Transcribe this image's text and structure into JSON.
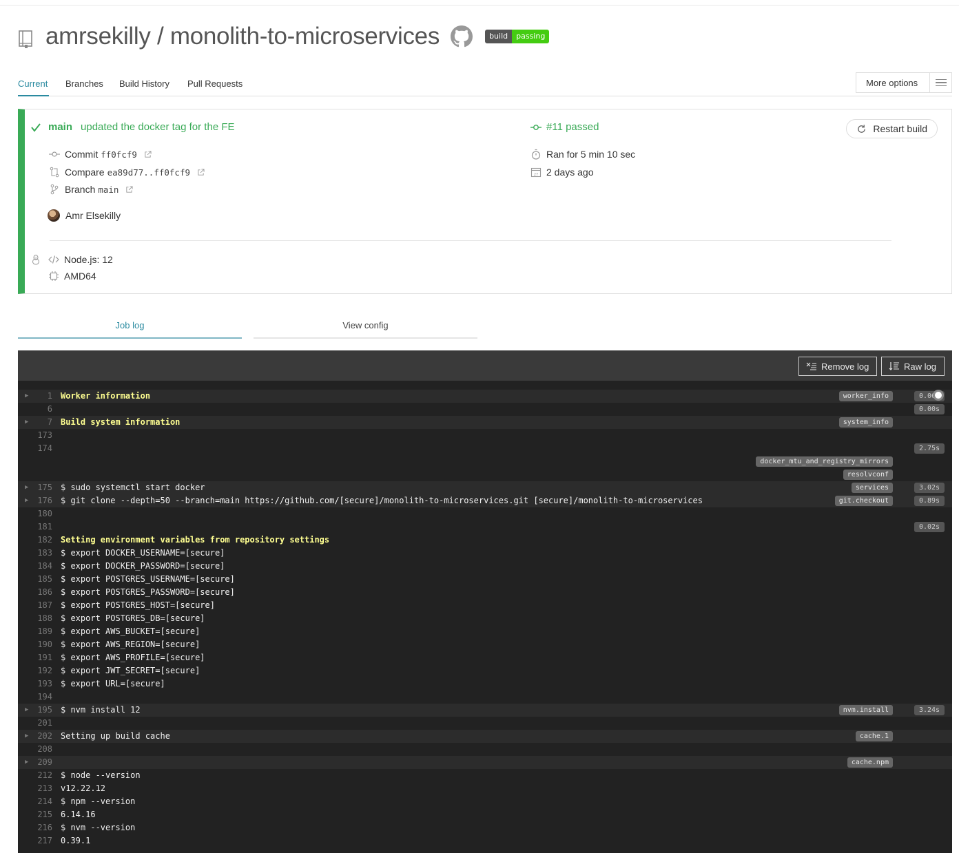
{
  "header": {
    "repo_title": "amrsekilly / monolith-to-microservices",
    "badge_left": "build",
    "badge_right": "passing"
  },
  "tabs": {
    "current": "Current",
    "branches": "Branches",
    "build_history": "Build History",
    "pull_requests": "Pull Requests",
    "more_options": "More options"
  },
  "build": {
    "branch": "main",
    "message": "updated the docker tag for the FE",
    "number_status": "#11 passed",
    "restart_label": "Restart build",
    "commit_label": "Commit",
    "commit_sha": "ff0fcf9",
    "compare_label": "Compare",
    "compare_range": "ea89d77..ff0fcf9",
    "branch_label": "Branch",
    "branch_name": "main",
    "author": "Amr Elsekilly",
    "ran_for": "Ran for 5 min 10 sec",
    "when": "2 days ago",
    "language": "Node.js: 12",
    "arch": "AMD64",
    "status_color": "#39aa56"
  },
  "log_tabs": {
    "job_log": "Job log",
    "view_config": "View config"
  },
  "log_toolbar": {
    "remove_log": "Remove log",
    "raw_log": "Raw log"
  },
  "log": {
    "lines": [
      {
        "num": "1",
        "text": "Worker information",
        "hl": true,
        "fold": true,
        "tag": "worker_info",
        "dur": "0.06s"
      },
      {
        "num": "6",
        "text": "",
        "dur": "0.00s"
      },
      {
        "num": "7",
        "text": "Build system information",
        "hl": true,
        "fold": true,
        "tag": "system_info"
      },
      {
        "num": "173",
        "text": ""
      },
      {
        "num": "174",
        "text": "",
        "dur": "2.75s"
      },
      {
        "num": "",
        "text": "",
        "tag": "docker_mtu_and_registry_mirrors"
      },
      {
        "num": "",
        "text": "",
        "tag": "resolvconf"
      },
      {
        "num": "175",
        "text": "$ sudo systemctl start docker",
        "fold": true,
        "tag": "services",
        "dur": "3.02s"
      },
      {
        "num": "176",
        "text": "$ git clone --depth=50 --branch=main https://github.com/[secure]/monolith-to-microservices.git [secure]/monolith-to-microservices",
        "fold": true,
        "tag": "git.checkout",
        "dur": "0.89s"
      },
      {
        "num": "180",
        "text": ""
      },
      {
        "num": "181",
        "text": "",
        "dur": "0.02s"
      },
      {
        "num": "182",
        "text": "Setting environment variables from repository settings",
        "hl": true
      },
      {
        "num": "183",
        "text": "$ export DOCKER_USERNAME=[secure]"
      },
      {
        "num": "184",
        "text": "$ export DOCKER_PASSWORD=[secure]"
      },
      {
        "num": "185",
        "text": "$ export POSTGRES_USERNAME=[secure]"
      },
      {
        "num": "186",
        "text": "$ export POSTGRES_PASSWORD=[secure]"
      },
      {
        "num": "187",
        "text": "$ export POSTGRES_HOST=[secure]"
      },
      {
        "num": "188",
        "text": "$ export POSTGRES_DB=[secure]"
      },
      {
        "num": "189",
        "text": "$ export AWS_BUCKET=[secure]"
      },
      {
        "num": "190",
        "text": "$ export AWS_REGION=[secure]"
      },
      {
        "num": "191",
        "text": "$ export AWS_PROFILE=[secure]"
      },
      {
        "num": "192",
        "text": "$ export JWT_SECRET=[secure]"
      },
      {
        "num": "193",
        "text": "$ export URL=[secure]"
      },
      {
        "num": "194",
        "text": ""
      },
      {
        "num": "195",
        "text": "$ nvm install 12",
        "fold": true,
        "tag": "nvm.install",
        "dur": "3.24s"
      },
      {
        "num": "201",
        "text": ""
      },
      {
        "num": "202",
        "text": "Setting up build cache",
        "fold": true,
        "tag": "cache.1"
      },
      {
        "num": "208",
        "text": ""
      },
      {
        "num": "209",
        "text": "",
        "fold": true,
        "tag": "cache.npm"
      },
      {
        "num": "212",
        "text": "$ node --version"
      },
      {
        "num": "213",
        "text": "v12.22.12"
      },
      {
        "num": "214",
        "text": "$ npm --version"
      },
      {
        "num": "215",
        "text": "6.14.16"
      },
      {
        "num": "216",
        "text": "$ nvm --version"
      },
      {
        "num": "217",
        "text": "0.39.1"
      }
    ]
  }
}
